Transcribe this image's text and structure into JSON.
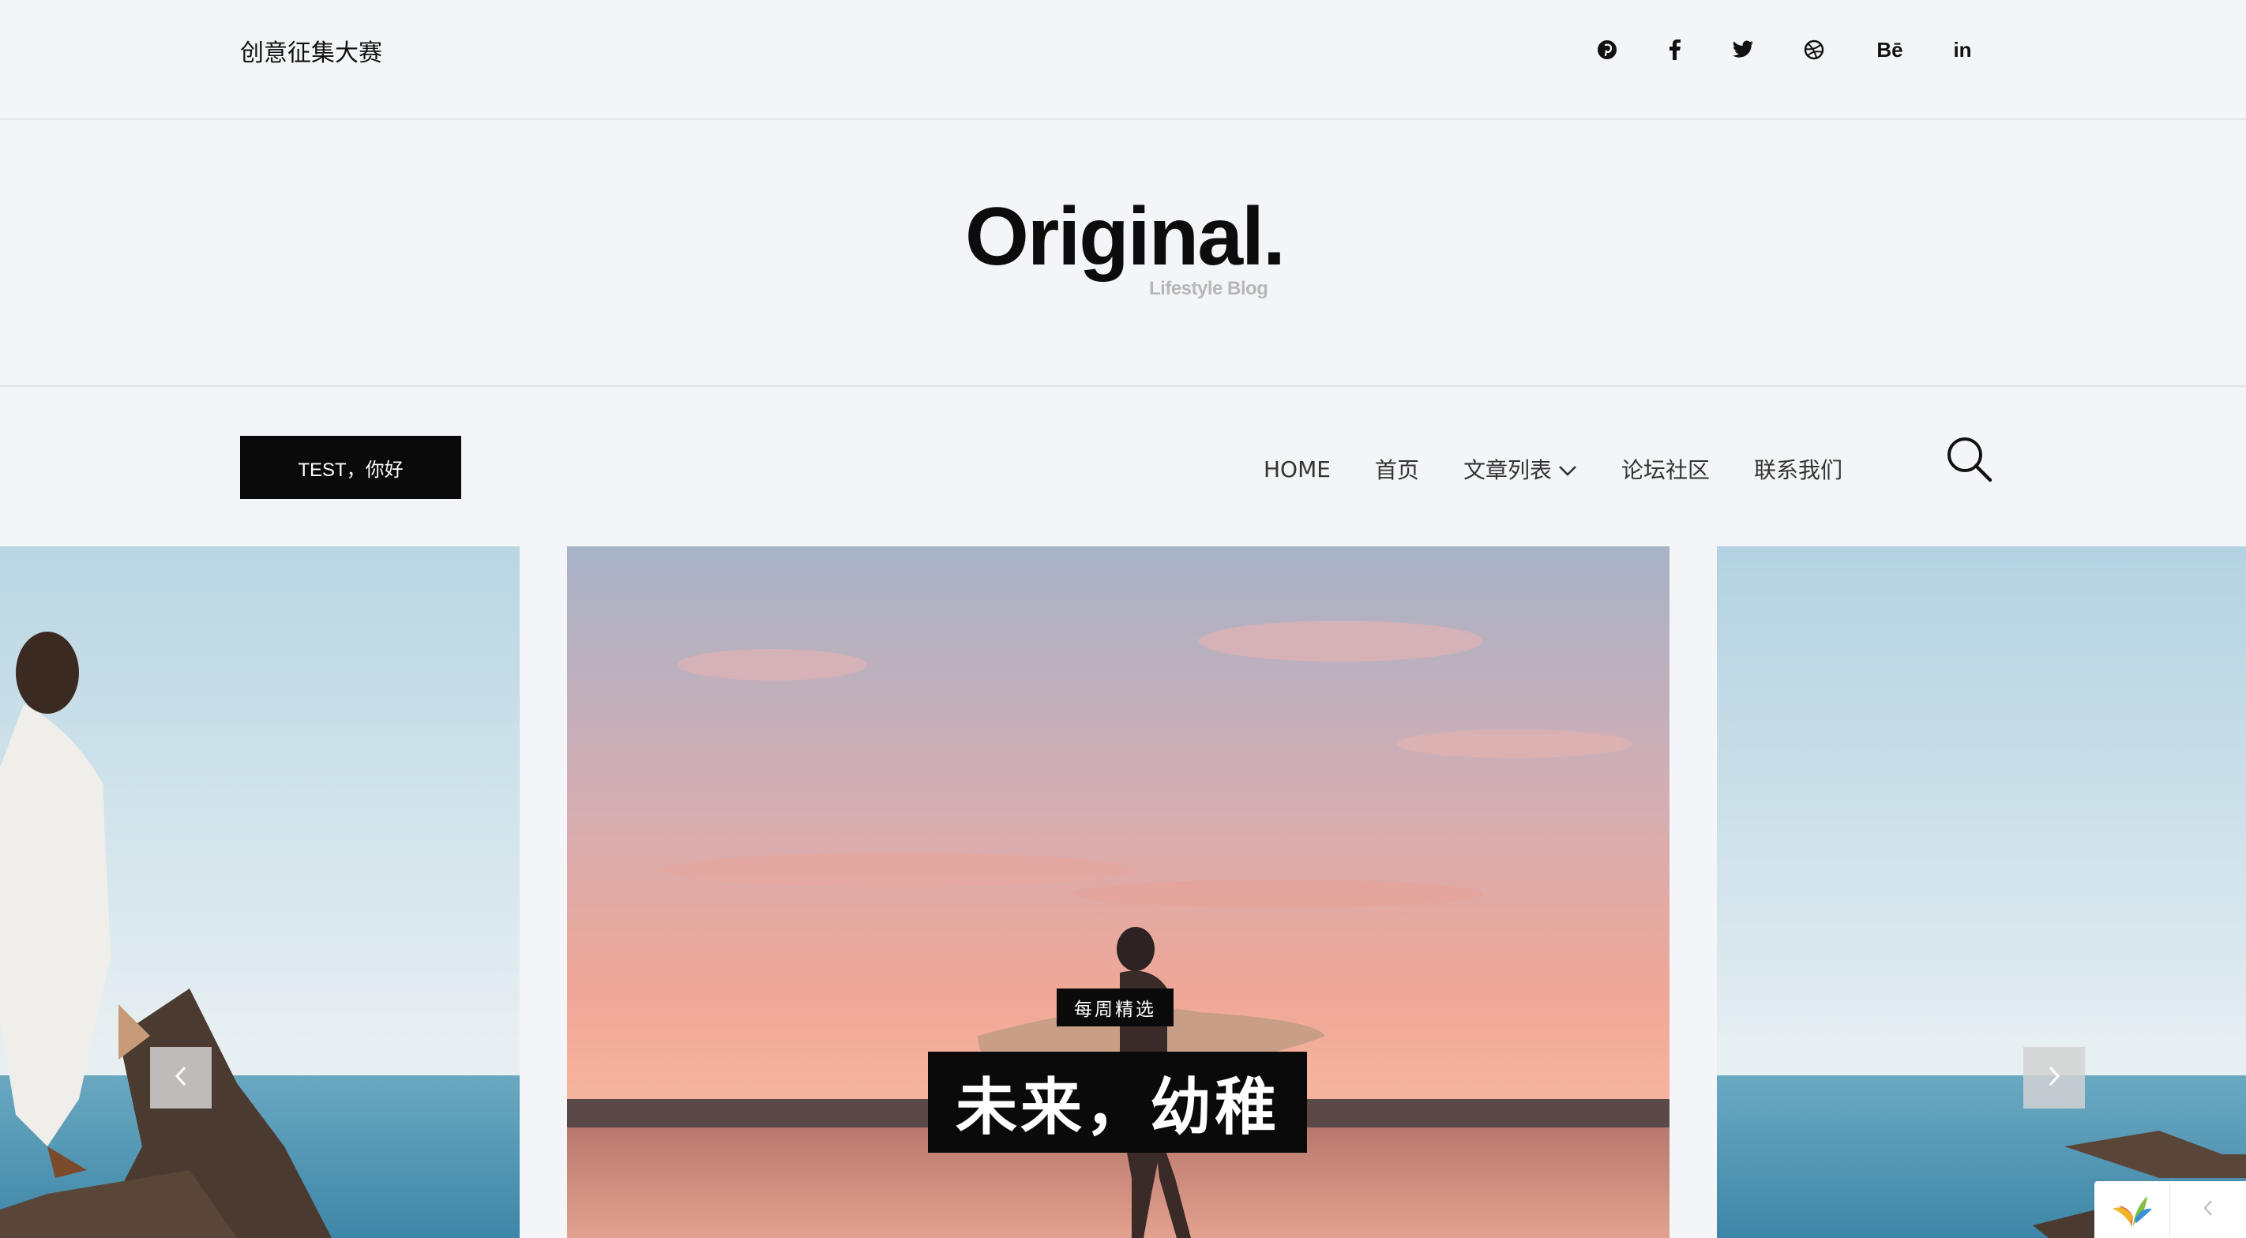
{
  "header": {
    "site_name": "创意征集大赛",
    "social_icons": [
      "pinterest-icon",
      "facebook-icon",
      "twitter-icon",
      "dribbble-icon",
      "behance-icon",
      "linkedin-icon"
    ],
    "behance_text": "Bē",
    "linkedin_text": "in"
  },
  "logo": {
    "title": "Original.",
    "tagline": "Lifestyle Blog"
  },
  "nav": {
    "button_label": "TEST，你好",
    "links": [
      "HOME",
      "首页",
      "文章列表",
      "论坛社区",
      "联系我们"
    ],
    "dropdown_index": 2,
    "search_icon": "search-icon"
  },
  "slider": {
    "category": "每周精选",
    "title": "未来，幼稚",
    "prev_icon": "chevron-left-icon",
    "next_icon": "chevron-right-icon"
  },
  "colors": {
    "background": "#f4f5f8",
    "dark": "#0a0a0a",
    "divider": "#e2e4e8"
  }
}
